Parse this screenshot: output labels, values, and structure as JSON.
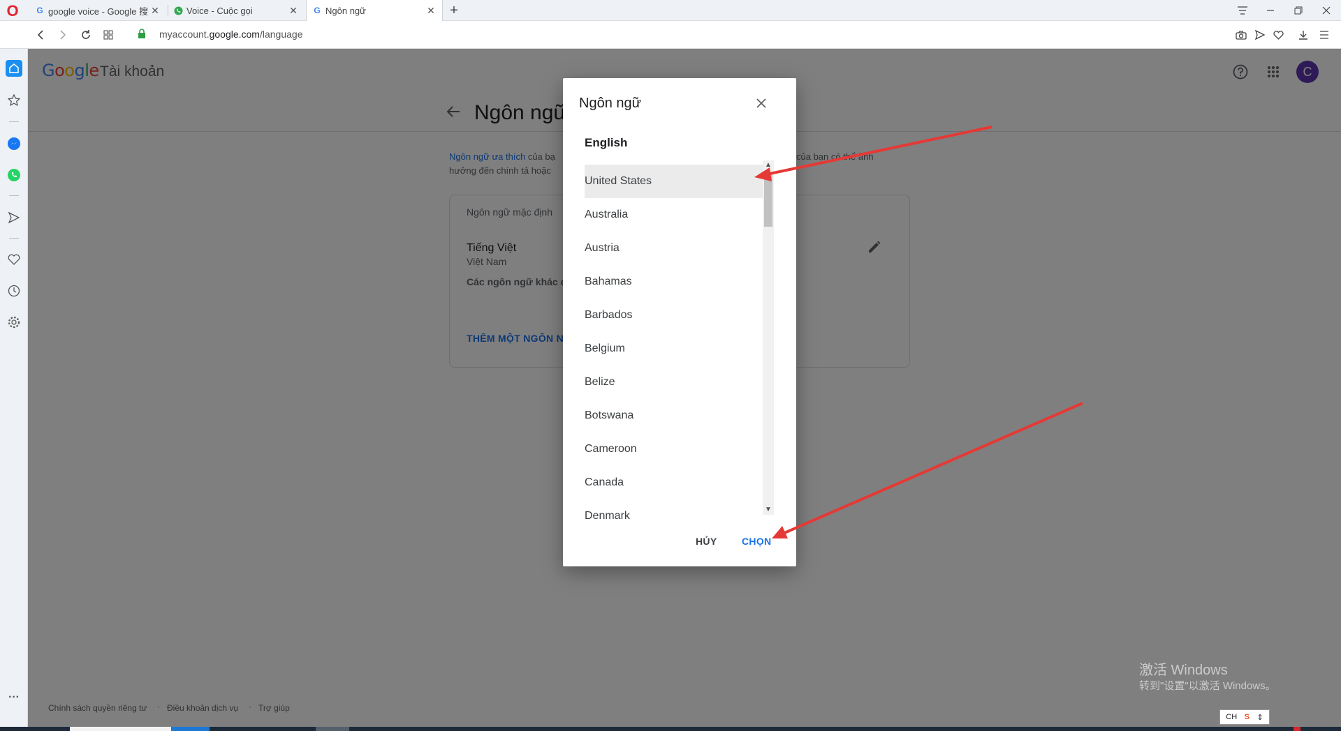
{
  "browser": {
    "tabs": [
      {
        "title": "google voice - Google 搜",
        "favicon": "G"
      },
      {
        "title": "Voice - Cuộc gọi",
        "favicon": "phone-icon"
      },
      {
        "title": "Ngôn ngữ",
        "favicon": "G"
      }
    ],
    "url_prefix": "myaccount.",
    "url_domain": "google.com",
    "url_path": "/language"
  },
  "page": {
    "brand": "Google",
    "brand_suffix": "Tài khoản",
    "avatar_letter": "C",
    "title": "Ngôn ngữ",
    "intro_link": "Ngôn ngữ ưa thích",
    "intro_text_a": " của bạ",
    "intro_text_b": "của bạn có thể ảnh",
    "intro_line2": "hưởng đến chính tả hoặc",
    "default_label": "Ngôn ngữ mặc định",
    "default_lang": "Tiếng Việt",
    "default_region": "Việt Nam",
    "other_label": "Các ngôn ngữ khác c",
    "add_button": "THÊM MỘT NGÔN N"
  },
  "dialog": {
    "title": "Ngôn ngữ",
    "subtitle": "English",
    "options": [
      "United States",
      "Australia",
      "Austria",
      "Bahamas",
      "Barbados",
      "Belgium",
      "Belize",
      "Botswana",
      "Cameroon",
      "Canada",
      "Denmark"
    ],
    "selected": "United States",
    "cancel": "HỦY",
    "confirm": "CHỌN"
  },
  "footer": {
    "privacy": "Chính sách quyền riêng tư",
    "terms": "Điều khoản dịch vụ",
    "help": "Trợ giúp"
  },
  "watermark": {
    "line1": "激活 Windows",
    "line2": "转到\"设置\"以激活 Windows。"
  },
  "ime": {
    "label": "CH"
  },
  "colors": {
    "accent": "#1a73e8",
    "arrow": "#e53935",
    "avatar": "#5e35b1"
  }
}
